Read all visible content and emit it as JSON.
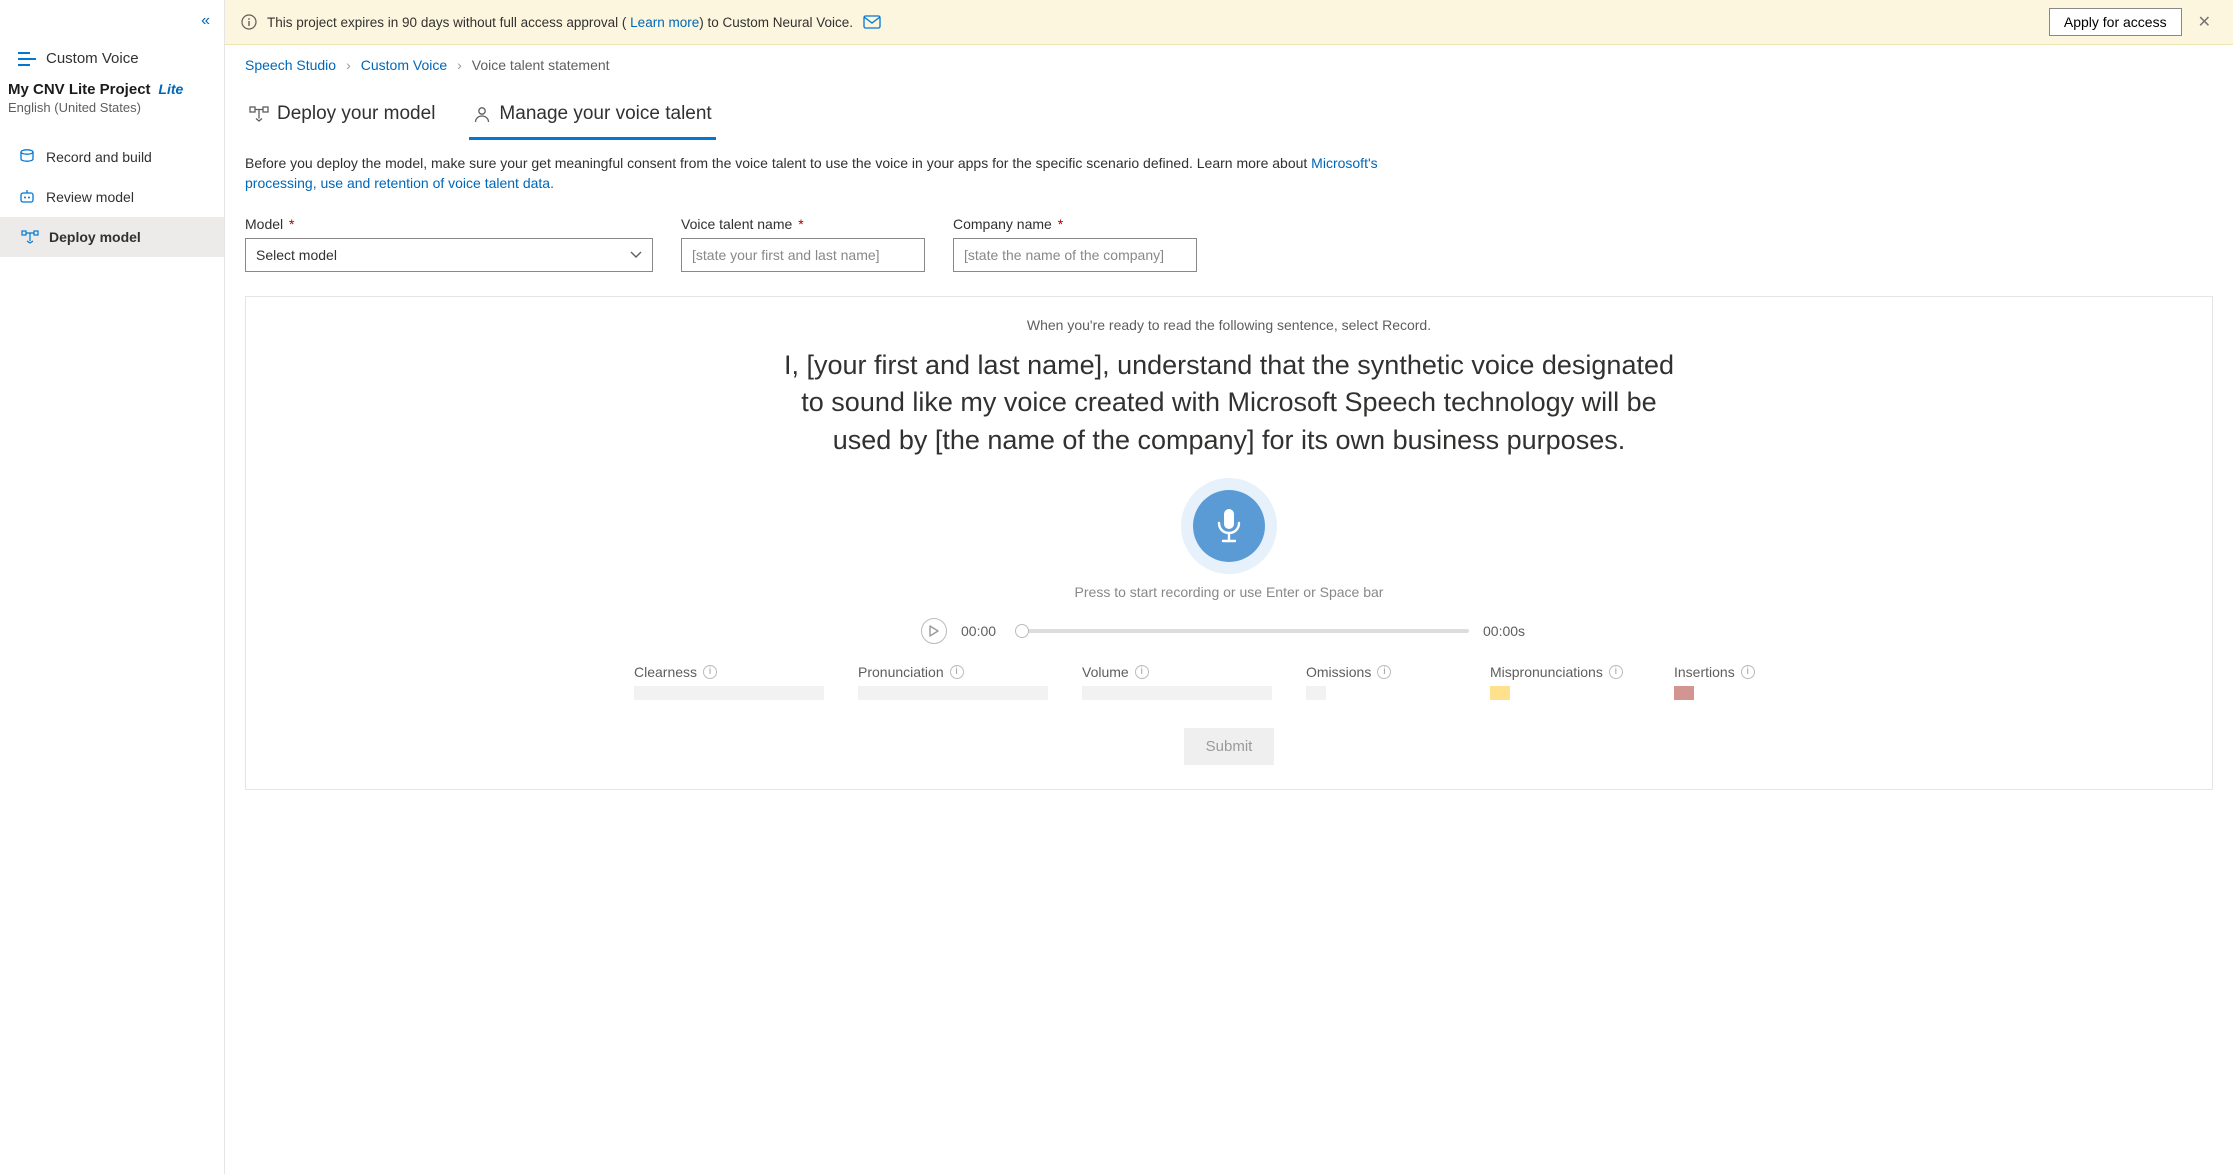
{
  "sidebar": {
    "product": "Custom Voice",
    "project_name": "My CNV Lite Project",
    "project_badge": "Lite",
    "project_locale": "English (United States)",
    "items": [
      {
        "label": "Record and build"
      },
      {
        "label": "Review model"
      },
      {
        "label": "Deploy model"
      }
    ]
  },
  "banner": {
    "text_before": "This project expires in 90 days without full access approval ( ",
    "link": "Learn more",
    "text_after": ") to Custom Neural Voice.",
    "apply": "Apply for access"
  },
  "breadcrumbs": {
    "a": "Speech Studio",
    "b": "Custom Voice",
    "c": "Voice talent statement"
  },
  "tabs": {
    "deploy": "Deploy your model",
    "manage": "Manage your voice talent"
  },
  "description": {
    "text": "Before you deploy the model, make sure your get meaningful consent from the voice talent to use the voice in your apps for the specific scenario defined. Learn more about ",
    "link": "Microsoft's processing, use and retention of voice talent data."
  },
  "form": {
    "model_label": "Model",
    "model_placeholder": "Select model",
    "talent_label": "Voice talent name",
    "talent_placeholder": "[state your first and last name]",
    "company_label": "Company name",
    "company_placeholder": "[state the name of the company]"
  },
  "panel": {
    "hint": "When you're ready to read the following sentence, select Record.",
    "statement": "I, [your first and last name], understand that the synthetic voice designated to sound like my voice created with Microsoft Speech technology will be used by [the name of the company] for its own business purposes.",
    "record_hint": "Press to start recording or use Enter or Space bar",
    "time": "00:00",
    "duration": "00:00s",
    "submit": "Submit"
  },
  "metrics": {
    "clearness": "Clearness",
    "pronunciation": "Pronunciation",
    "volume": "Volume",
    "omissions": "Omissions",
    "mispronunciations": "Mispronunciations",
    "insertions": "Insertions"
  }
}
